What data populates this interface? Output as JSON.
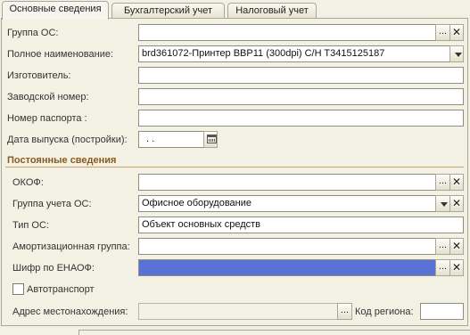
{
  "tabs": [
    {
      "label": "Основные сведения",
      "active": true
    },
    {
      "label": "Бухгалтерский учет",
      "active": false
    },
    {
      "label": "Налоговый учет",
      "active": false
    }
  ],
  "fields": {
    "gruppa_os": {
      "label": "Группа ОС:",
      "value": ""
    },
    "polnoe_naimenovanie": {
      "label": "Полное наименование:",
      "value": "brd361072-Принтер BBP11 (300dpi) C/H T3415125187"
    },
    "izgotovitel": {
      "label": "Изготовитель:",
      "value": ""
    },
    "zavodskoy_nomer": {
      "label": "Заводской номер:",
      "value": ""
    },
    "nomer_pasporta": {
      "label": "Номер паспорта :",
      "value": ""
    },
    "data_vypuska": {
      "label": "Дата выпуска (постройки):",
      "value": " .  ."
    }
  },
  "section": {
    "title": "Постоянные сведения"
  },
  "permanent": {
    "okof": {
      "label": "ОКОФ:",
      "value": ""
    },
    "gruppa_ucheta": {
      "label": "Группа учета ОС:",
      "value": "Офисное оборудование"
    },
    "tip_os": {
      "label": "Тип ОС:",
      "value": "Объект основных средств"
    },
    "amort_gruppa": {
      "label": "Амортизационная группа:",
      "value": ""
    },
    "shifr_enaof": {
      "label": "Шифр по ЕНАОФ:",
      "value": "",
      "selected": true
    },
    "avtotransport": {
      "label": "Автотранспорт",
      "checked": false
    },
    "adres": {
      "label": "Адрес местонахождения:",
      "value": ""
    },
    "kod_regiona": {
      "label": "Код региона:",
      "value": ""
    }
  },
  "buttons": {
    "select": "...",
    "clear": "✕"
  },
  "colors": {
    "accent_section": "#8a5a1e",
    "selected_field": "#5a72d6"
  },
  "icons": {
    "date_picker": "calendar-icon",
    "dropdown": "chevron-down-icon",
    "clear": "close-icon"
  }
}
